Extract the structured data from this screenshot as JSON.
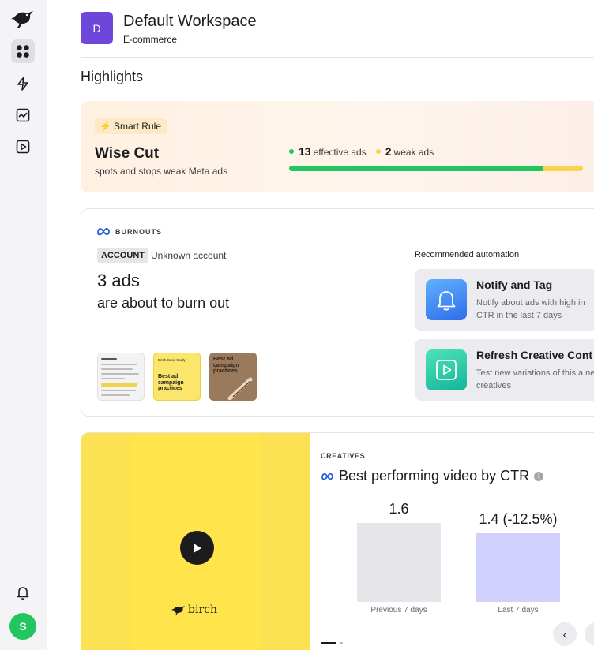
{
  "workspace": {
    "initial": "D",
    "name": "Default Workspace",
    "type": "E-commerce"
  },
  "sidebar": {
    "user_initial": "S"
  },
  "highlights_title": "Highlights",
  "smart_rule": {
    "badge": "Smart Rule",
    "title": "Wise Cut",
    "subtitle": "spots and stops weak Meta ads",
    "effective_count": "13",
    "effective_label": "effective ads",
    "weak_count": "2",
    "weak_label": "weak ads",
    "effective_fraction": 0.866,
    "colors": {
      "effective": "#22c55e",
      "weak": "#fcd34d"
    }
  },
  "burnouts": {
    "label": "BURNOUTS",
    "account_tag": "ACCOUNT",
    "account_value": "Unknown account",
    "count_text": "3 ads",
    "description": "are about to burn out",
    "thumbs": {
      "two_header": "Birch Case Study",
      "two_text": "Best ad campaign practices",
      "three_text": "Best ad campaign practices"
    },
    "recommended_label": "Recommended automation",
    "recommendations": [
      {
        "icon": "bell-icon",
        "title": "Notify and Tag",
        "desc": "Notify about ads with high in CTR in the last 7 days"
      },
      {
        "icon": "play-square-icon",
        "title": "Refresh Creative Cont",
        "desc": "Test new variations of this a new creatives"
      }
    ]
  },
  "creatives": {
    "label": "CREATIVES",
    "title": "Best performing video by CTR",
    "brand": "birch",
    "chart_data": {
      "type": "bar",
      "categories": [
        "Previous 7 days",
        "Last 7 days"
      ],
      "values": [
        1.6,
        1.4
      ],
      "value_labels": [
        "1.6",
        "1.4 (-12.5%)"
      ],
      "colors": [
        "#e6e6ea",
        "#cfd0fb"
      ]
    }
  }
}
